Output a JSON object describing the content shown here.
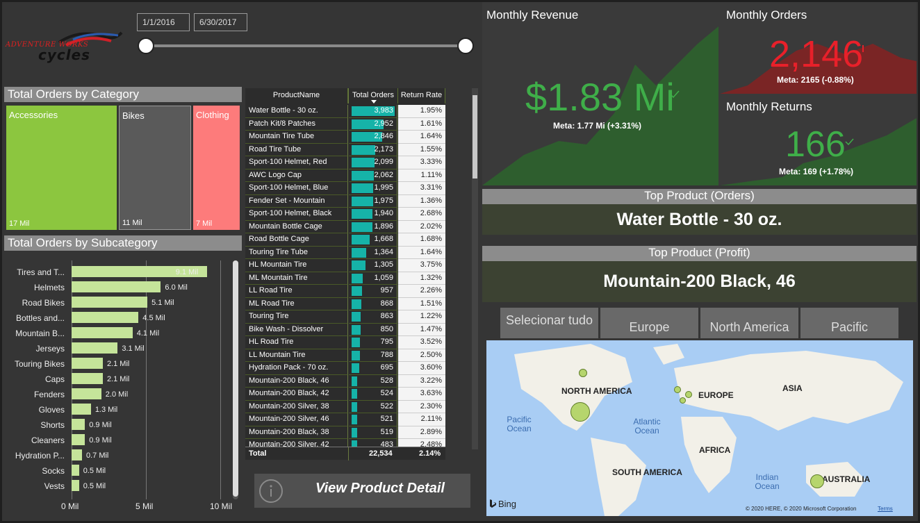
{
  "logo": {
    "line1": "ADVENTURE WORKS",
    "line2": "cycles"
  },
  "date_slicer": {
    "start": "1/1/2016",
    "end": "6/30/2017"
  },
  "category_chart": {
    "title": "Total Orders by Category",
    "items": [
      {
        "label": "Accessories",
        "value": "17 Mil",
        "color": "#8cc63f"
      },
      {
        "label": "Bikes",
        "value": "11 Mil",
        "color": "#5a5a5a"
      },
      {
        "label": "Clothing",
        "value": "7 Mil",
        "color": "#fd7b7b"
      }
    ]
  },
  "chart_data": {
    "type": "bar",
    "title": "Total Orders by Subcategory",
    "categories": [
      "Tires and T...",
      "Helmets",
      "Road Bikes",
      "Bottles and...",
      "Mountain B...",
      "Jerseys",
      "Touring Bikes",
      "Caps",
      "Fenders",
      "Gloves",
      "Shorts",
      "Cleaners",
      "Hydration P...",
      "Socks",
      "Vests"
    ],
    "values": [
      9.1,
      6.0,
      5.1,
      4.5,
      4.1,
      3.1,
      2.1,
      2.1,
      2.0,
      1.3,
      0.9,
      0.9,
      0.7,
      0.5,
      0.5
    ],
    "value_labels": [
      "9.1 Mil",
      "6.0 Mil",
      "5.1 Mil",
      "4.5 Mil",
      "4.1 Mil",
      "3.1 Mil",
      "2.1 Mil",
      "2.1 Mil",
      "2.0 Mil",
      "1.3 Mil",
      "0.9 Mil",
      "0.9 Mil",
      "0.7 Mil",
      "0.5 Mil",
      "0.5 Mil"
    ],
    "xlim": [
      0,
      10
    ],
    "xticks": [
      "0 Mil",
      "5 Mil",
      "10 Mil"
    ],
    "orientation": "horizontal",
    "grid": true,
    "bar_color": "#c5e49a"
  },
  "table": {
    "columns": [
      "ProductName",
      "Total Orders",
      "Return Rate"
    ],
    "rows": [
      {
        "name": "Water Bottle - 30 oz.",
        "orders": "3,983",
        "n": 3983,
        "rate": "1.95%"
      },
      {
        "name": "Patch Kit/8 Patches",
        "orders": "2,952",
        "n": 2952,
        "rate": "1.61%"
      },
      {
        "name": "Mountain Tire Tube",
        "orders": "2,846",
        "n": 2846,
        "rate": "1.64%"
      },
      {
        "name": "Road Tire Tube",
        "orders": "2,173",
        "n": 2173,
        "rate": "1.55%"
      },
      {
        "name": "Sport-100 Helmet, Red",
        "orders": "2,099",
        "n": 2099,
        "rate": "3.33%"
      },
      {
        "name": "AWC Logo Cap",
        "orders": "2,062",
        "n": 2062,
        "rate": "1.11%"
      },
      {
        "name": "Sport-100 Helmet, Blue",
        "orders": "1,995",
        "n": 1995,
        "rate": "3.31%"
      },
      {
        "name": "Fender Set - Mountain",
        "orders": "1,975",
        "n": 1975,
        "rate": "1.36%"
      },
      {
        "name": "Sport-100 Helmet, Black",
        "orders": "1,940",
        "n": 1940,
        "rate": "2.68%"
      },
      {
        "name": "Mountain Bottle Cage",
        "orders": "1,896",
        "n": 1896,
        "rate": "2.02%"
      },
      {
        "name": "Road Bottle Cage",
        "orders": "1,668",
        "n": 1668,
        "rate": "1.68%"
      },
      {
        "name": "Touring Tire Tube",
        "orders": "1,364",
        "n": 1364,
        "rate": "1.64%"
      },
      {
        "name": "HL Mountain Tire",
        "orders": "1,305",
        "n": 1305,
        "rate": "3.75%"
      },
      {
        "name": "ML Mountain Tire",
        "orders": "1,059",
        "n": 1059,
        "rate": "1.32%"
      },
      {
        "name": "LL Road Tire",
        "orders": "957",
        "n": 957,
        "rate": "2.26%"
      },
      {
        "name": "ML Road Tire",
        "orders": "868",
        "n": 868,
        "rate": "1.51%"
      },
      {
        "name": "Touring Tire",
        "orders": "863",
        "n": 863,
        "rate": "1.22%"
      },
      {
        "name": "Bike Wash - Dissolver",
        "orders": "850",
        "n": 850,
        "rate": "1.47%"
      },
      {
        "name": "HL Road Tire",
        "orders": "795",
        "n": 795,
        "rate": "3.52%"
      },
      {
        "name": "LL Mountain Tire",
        "orders": "788",
        "n": 788,
        "rate": "2.50%"
      },
      {
        "name": "Hydration Pack - 70 oz.",
        "orders": "695",
        "n": 695,
        "rate": "3.60%"
      },
      {
        "name": "Mountain-200 Black, 46",
        "orders": "528",
        "n": 528,
        "rate": "3.22%"
      },
      {
        "name": "Mountain-200 Black, 42",
        "orders": "524",
        "n": 524,
        "rate": "3.63%"
      },
      {
        "name": "Mountain-200 Silver, 38",
        "orders": "522",
        "n": 522,
        "rate": "2.30%"
      },
      {
        "name": "Mountain-200 Silver, 46",
        "orders": "521",
        "n": 521,
        "rate": "2.11%"
      },
      {
        "name": "Mountain-200 Black, 38",
        "orders": "519",
        "n": 519,
        "rate": "2.89%"
      },
      {
        "name": "Mountain-200 Silver, 42",
        "orders": "483",
        "n": 483,
        "rate": "2.48%"
      }
    ],
    "total": {
      "label": "Total",
      "orders": "22,534",
      "rate": "2.14%"
    }
  },
  "view_button": {
    "label": "View Product Detail",
    "icon": "info-icon"
  },
  "kpi": {
    "revenue": {
      "title": "Monthly Revenue",
      "value": "$1.83 Mi",
      "meta": "Meta: 1.77 Mi (+3.31%)",
      "color": "#3fae49"
    },
    "orders": {
      "title": "Monthly Orders",
      "value": "2,146",
      "meta": "Meta: 2165 (-0.88%)",
      "color": "#e8202a"
    },
    "returns": {
      "title": "Monthly Returns",
      "value": "166",
      "meta": "Meta: 169 (+1.78%)",
      "color": "#3fae49"
    }
  },
  "top_product_orders": {
    "title": "Top Product (Orders)",
    "value": "Water Bottle - 30 oz."
  },
  "top_product_profit": {
    "title": "Top Product (Profit)",
    "value": "Mountain-200 Black, 46"
  },
  "region_slicer": [
    "Selecionar tudo",
    "Europe",
    "North America",
    "Pacific"
  ],
  "map": {
    "continents": [
      "NORTH AMERICA",
      "EUROPE",
      "ASIA",
      "AFRICA",
      "SOUTH AMERICA",
      "AUSTRALIA"
    ],
    "oceans": [
      "Pacific Ocean",
      "Atlantic Ocean",
      "Indian Ocean"
    ],
    "brand": "Bing",
    "attribution": "© 2020 HERE, © 2020 Microsoft Corporation",
    "terms": "Terms"
  }
}
